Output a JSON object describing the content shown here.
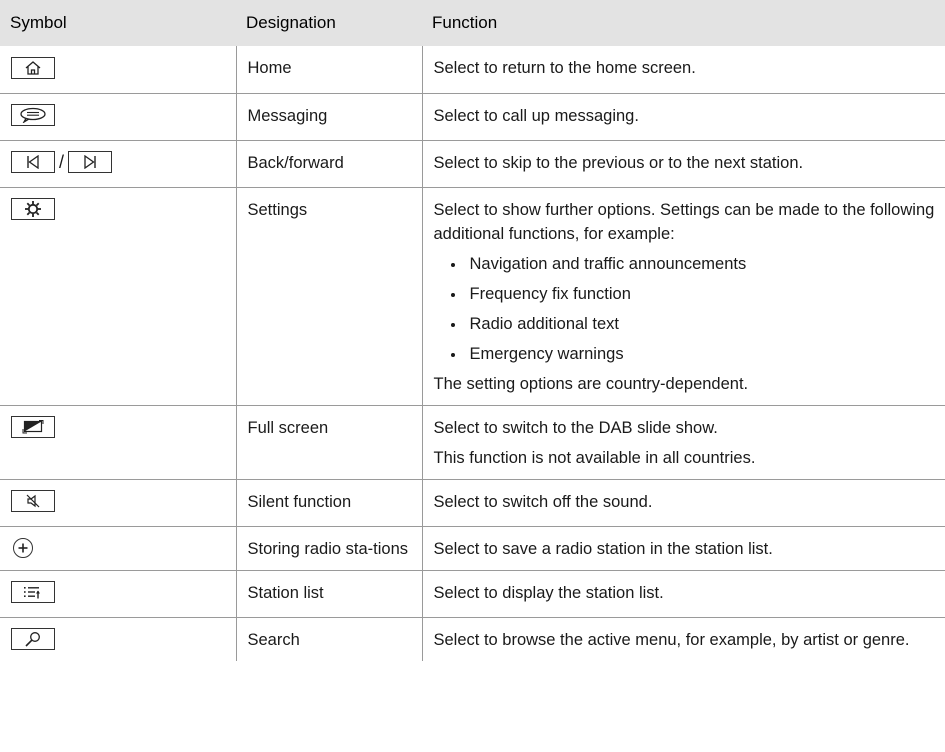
{
  "headers": {
    "symbol": "Symbol",
    "designation": "Designation",
    "function": "Function"
  },
  "rows": [
    {
      "designation": "Home",
      "function": [
        "Select to return to the home screen."
      ]
    },
    {
      "designation": "Messaging",
      "function": [
        "Select to call up messaging."
      ]
    },
    {
      "designation": "Back/forward",
      "symbol_separator": "/",
      "function": [
        "Select to skip to the previous or to the next station."
      ]
    },
    {
      "designation": "Settings",
      "function": [
        "Select to show further options. Settings can be made to the following additional functions, for example:"
      ],
      "bullets": [
        "Navigation and traffic announcements",
        "Frequency fix function",
        "Radio additional text",
        "Emergency warnings"
      ],
      "note": "The setting options are country-dependent."
    },
    {
      "designation": "Full screen",
      "function": [
        "Select to switch to the DAB slide show.",
        "This function is not available in all countries."
      ]
    },
    {
      "designation": "Silent function",
      "function": [
        "Select to switch off the sound."
      ]
    },
    {
      "designation": "Storing radio sta-tions",
      "function": [
        "Select to save a radio station in the station list."
      ]
    },
    {
      "designation": "Station list",
      "function": [
        "Select to display the station list."
      ]
    },
    {
      "designation": "Search",
      "function": [
        "Select to browse the active menu, for example, by artist or genre."
      ]
    }
  ],
  "icons": [
    "home-icon",
    "messaging-icon",
    "back-icon",
    "forward-icon",
    "settings-icon",
    "fullscreen-icon",
    "mute-icon",
    "add-station-icon",
    "station-list-icon",
    "search-icon"
  ]
}
